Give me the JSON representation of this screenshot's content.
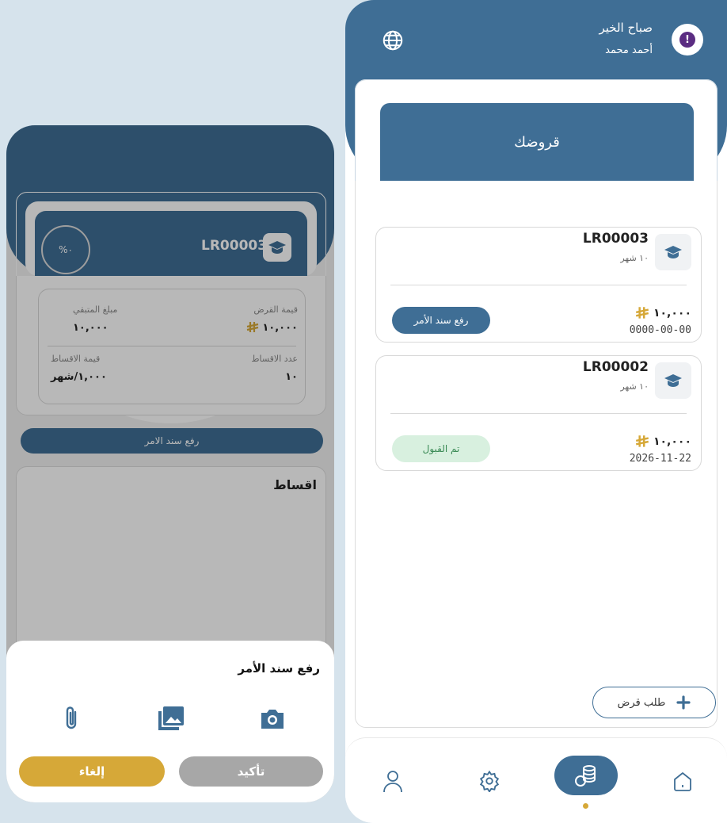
{
  "colors": {
    "primary": "#3f6e95",
    "gold": "#d6a838",
    "accepted_bg": "#d8f0df",
    "accepted_fg": "#3a8a55"
  },
  "left": {
    "loan_id": "LR00003",
    "progress": "%٠",
    "loan_value_label": "قيمة القرض",
    "loan_value": "١٠,٠٠٠",
    "remaining_label": "مبلغ المتبقي",
    "remaining": "١٠,٠٠٠",
    "installments_count_label": "عدد الاقساط",
    "installments_count": "١٠",
    "installment_value_label": "قيمة الاقساط",
    "installment_value": "١,٠٠٠/شهر",
    "upload_label": "رفع سند الامر",
    "installments_title": "اقساط",
    "sheet": {
      "title": "رفع سند الأمر",
      "confirm": "تأكيد",
      "cancel": "إلغاء"
    }
  },
  "right": {
    "greeting": "صباح الخير",
    "user_name": "أحمد محمد",
    "section_title": "قروضك",
    "loans": [
      {
        "id": "LR00003",
        "months": "١٠ شهر",
        "amount": "١٠,٠٠٠",
        "date": "0000-00-00",
        "action": "رفع سند الأمر"
      },
      {
        "id": "LR00002",
        "months": "١٠ شهر",
        "amount": "١٠,٠٠٠",
        "date": "2026-11-22",
        "action": "تم القبول"
      }
    ],
    "request_loan": "طلب قرض"
  },
  "icons": {
    "globe": "globe-icon",
    "alert": "alert-icon",
    "cap": "graduation-cap-icon",
    "share": "share-arrow-icon",
    "attach": "paperclip-icon",
    "gallery": "gallery-icon",
    "camera": "camera-icon",
    "plus": "plus-icon",
    "profile": "person-icon",
    "settings": "gear-icon",
    "loans": "coins-icon",
    "home": "home-icon",
    "riyal": "riyal-sign-icon"
  }
}
